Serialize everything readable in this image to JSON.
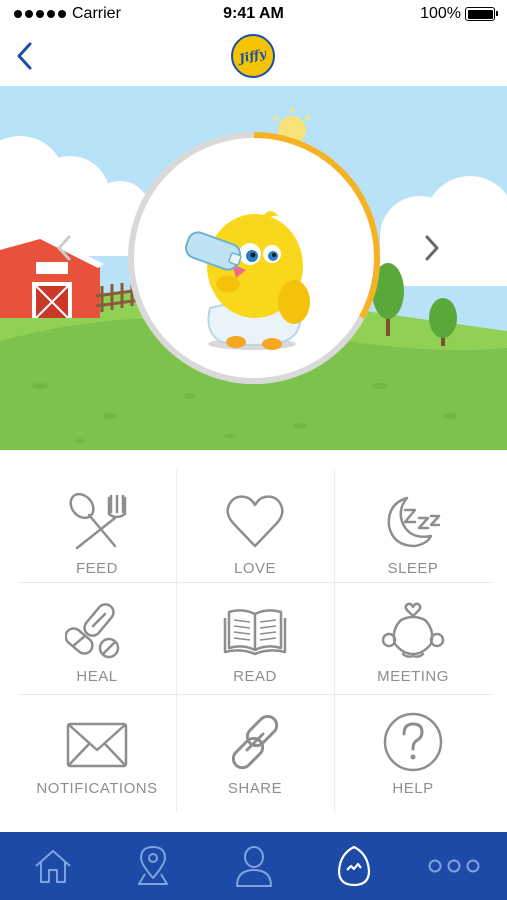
{
  "status_bar": {
    "carrier": "Carrier",
    "time": "9:41 AM",
    "battery": "100%"
  },
  "header": {
    "logo_text": "Jiffy",
    "back_icon": "chevron-left-icon"
  },
  "scene": {
    "progress_fraction": 0.33,
    "progress_color": "#f5b324",
    "ring_color": "#d9d9d9",
    "sky_color": "#b8e2f7",
    "grass_color": "#7cc24c"
  },
  "menu": {
    "feed": "FEED",
    "love": "LOVE",
    "sleep": "SLEEP",
    "heal": "HEAL",
    "read": "READ",
    "meeting": "MEETING",
    "notifications": "NOTIFICATIONS",
    "share": "SHARE",
    "help": "HELP"
  },
  "tab_bar": {
    "background": "#1c4aa6",
    "icons": [
      "home-icon",
      "map-pin-icon",
      "profile-icon",
      "egg-icon",
      "more-icon"
    ],
    "active": "egg-icon"
  },
  "colors": {
    "icon_gray": "#8e8e8e",
    "brand_blue": "#1a4faa",
    "brand_yellow": "#f5c400"
  }
}
